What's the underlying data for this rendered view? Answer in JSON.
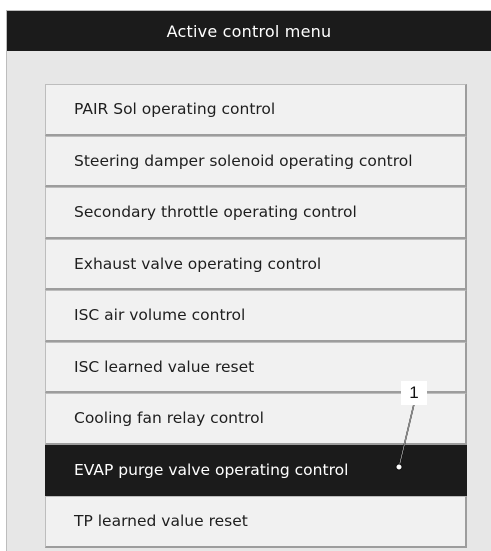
{
  "window": {
    "title": "Active control menu"
  },
  "menu": {
    "items": [
      {
        "label": "PAIR Sol operating control"
      },
      {
        "label": "Steering damper solenoid operating control"
      },
      {
        "label": "Secondary throttle operating control"
      },
      {
        "label": "Exhaust valve operating control"
      },
      {
        "label": "ISC air volume control"
      },
      {
        "label": "ISC learned value reset"
      },
      {
        "label": "Cooling fan relay control"
      },
      {
        "label": "EVAP purge valve operating control",
        "selected": true
      },
      {
        "label": "TP learned value reset"
      }
    ]
  },
  "callout": {
    "label": "1"
  },
  "colors": {
    "selected_bg": "#1b1b1b",
    "item_bg": "#f1f1f1",
    "window_bg": "#e7e7e7"
  }
}
